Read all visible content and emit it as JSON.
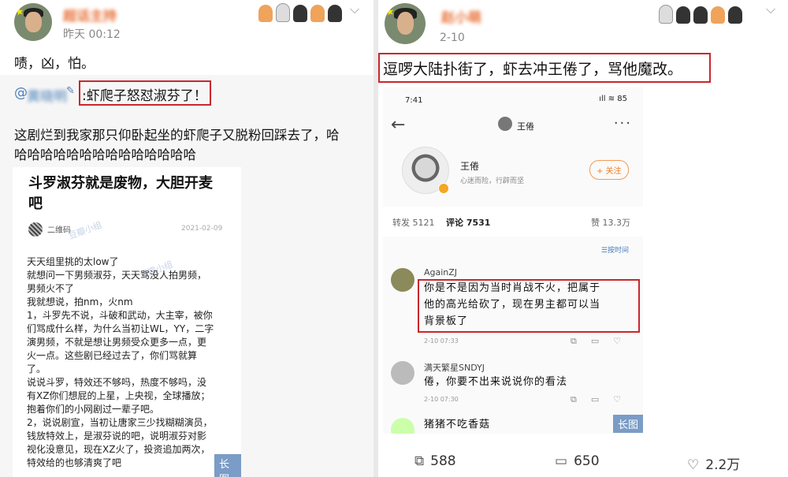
{
  "left": {
    "author_time": "昨天 00:12",
    "post_text": "啧，凶，怕。",
    "mention_prefix": "@",
    "mention_name": "黄晓明",
    "mention_suffix": "✎",
    "quote_highlight": ":虾爬子怒怼淑芬了！",
    "quote_line1": "这剧烂到我家那只仰卧起坐的虾爬子又脱粉回踩去了，哈",
    "quote_line2": "哈哈哈哈哈哈哈哈哈哈哈哈哈哈",
    "card": {
      "title": "斗罗淑芬就是废物，大胆开麦吧",
      "author": "二维码",
      "date": "2021-02-09",
      "watermark": "豆瓣小组",
      "body": "天天组里挑的太low了\n就想问一下男频淑芬，天天骂没人拍男频，\n男频火不了\n我就想说，拍nm，火nm\n1，斗罗先不说，斗破和武动，大主宰，被你\n们骂成什么样，为什么当初让WL，YY，二字\n演男频，不就是想让男频受众更多一点，更\n火一点。这些剧已经过去了，你们骂就算\n了。\n说说斗罗，特效还不够吗，热度不够吗，没\n有XZ你们想屁的上星，上央视，全球播放；\n抱着你们的小网剧过一辈子吧。\n2，说说剧宣，当初让唐家三少找糊糊演员，\n钱放特效上，是淑芬说的吧，说明淑芬对影\n视化没意见，现在XZ火了，投资追加两次，\n特效给的也够清爽了吧",
      "long_label": "长图"
    }
  },
  "right": {
    "author_name": "赵小萌",
    "author_time": "2-10",
    "post_text": "逗啰大陆扑街了，虾去冲王倦了，骂他魔改。",
    "phone": {
      "status_time": "7:41",
      "status_right": "ıll ≋ 85",
      "nav_title": "王倦",
      "profile_name": "王倦",
      "profile_motto": "心迷而险，行辟而坚",
      "follow_label": "+ 关注",
      "tabs": [
        "转发 5121",
        "评论 7531",
        "赞 13.3万"
      ],
      "sort_label": "☰按时间",
      "comments": [
        {
          "user": "AgainZJ",
          "lines": [
            "你是不是因为当时肖战不火，把属于",
            "他的高光给砍了，现在男主都可以当",
            "背景板了"
          ],
          "time": "2-10 07:33"
        },
        {
          "user": "满天繁星SNDYJ",
          "lines": [
            "倦，你要不出来说说你的看法"
          ],
          "time": "2-10 07:30"
        },
        {
          "user": "",
          "lines": [
            "猪猪不吃香菇"
          ],
          "time": ""
        }
      ],
      "long_label": "长图"
    },
    "bottom_bar": {
      "repost": "588",
      "comment": "650",
      "like": "2.2万"
    }
  },
  "colors": {
    "highlight_box": "#c9272c",
    "link": "#4a7fb8",
    "badge": "#7a9cc6"
  }
}
